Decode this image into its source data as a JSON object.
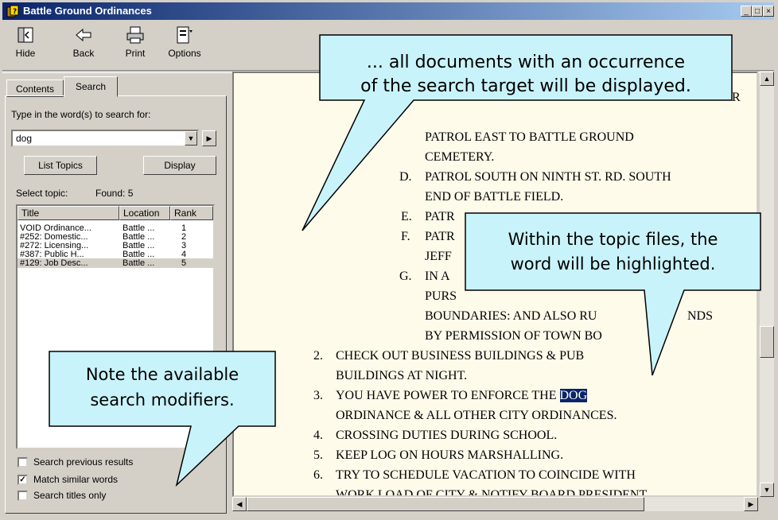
{
  "window": {
    "title": "Battle Ground Ordinances"
  },
  "toolbar": {
    "hide": "Hide",
    "back": "Back",
    "print": "Print",
    "options": "Options"
  },
  "tabs": {
    "contents": "Contents",
    "search": "Search"
  },
  "search": {
    "prompt": "Type in the word(s) to search for:",
    "query": "dog",
    "list_topics": "List Topics",
    "display": "Display",
    "select_topic": "Select topic:",
    "found": "Found: 5"
  },
  "results": {
    "columns": [
      "Title",
      "Location",
      "Rank"
    ],
    "rows": [
      [
        "VOID Ordinance...",
        "Battle ...",
        "1"
      ],
      [
        "#252: Domestic...",
        "Battle ...",
        "2"
      ],
      [
        "#272: Licensing...",
        "Battle ...",
        "3"
      ],
      [
        "#387: Public H...",
        "Battle ...",
        "4"
      ],
      [
        "#129: Job Desc...",
        "Battle ...",
        "5"
      ]
    ]
  },
  "options": {
    "prev_results": "Search previous results",
    "match_similar": "Match similar words",
    "titles_only": "Search titles only",
    "match_similar_checked": true
  },
  "document": {
    "lines": [
      "PATROL EAST TO BATTLE GROUND",
      "CEMETERY.",
      "D.",
      "PATROL SOUTH ON NINTH ST. RD. SOUTH",
      "END OF BATTLE FIELD.",
      "E.",
      "PATR",
      "F.",
      "PATR",
      "JEFF",
      "G.",
      "IN A",
      "PURS",
      "BOUNDARIES: AND ALSO RU",
      "NDS",
      "BY PERMISSION OF TOWN BO",
      "2.",
      "CHECK OUT BUSINESS BUILDINGS & PUB",
      "BUILDINGS AT NIGHT.",
      "3.",
      "YOU HAVE POWER TO ENFORCE THE ",
      "DOG",
      "ORDINANCE & ALL OTHER CITY ORDINANCES.",
      "4.",
      "CROSSING DUTIES DURING SCHOOL.",
      "5.",
      "KEEP LOG ON HOURS MARSHALLING.",
      "6.",
      "TRY TO SCHEDULE VACATION TO COINCIDE WITH",
      "WORK LOAD OF CITY & NOTIFY BOARD PRESIDENT",
      "R"
    ]
  },
  "callouts": {
    "top_line1": "... all documents with an occurrence",
    "top_line2": "of the search target will be displayed.",
    "right_line1": "Within the topic files, the",
    "right_line2": "word will be highlighted.",
    "left_line1": "Note the available",
    "left_line2": "search modifiers."
  }
}
